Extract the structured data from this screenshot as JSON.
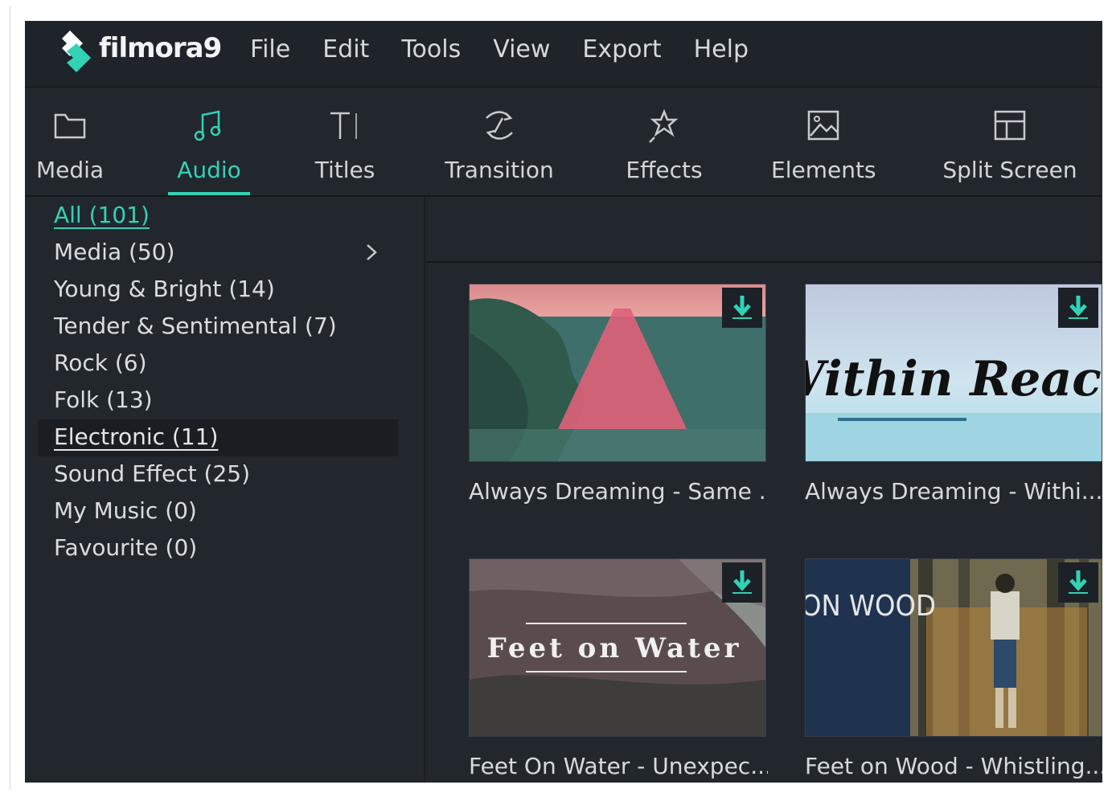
{
  "app": {
    "brand": "filmora9"
  },
  "menu": [
    "File",
    "Edit",
    "Tools",
    "View",
    "Export",
    "Help"
  ],
  "toolbar": {
    "tabs": [
      {
        "label": "Media",
        "icon": "folder-icon"
      },
      {
        "label": "Audio",
        "icon": "music-note-icon"
      },
      {
        "label": "Titles",
        "icon": "text-icon"
      },
      {
        "label": "Transition",
        "icon": "transition-icon"
      },
      {
        "label": "Effects",
        "icon": "effects-star-icon"
      },
      {
        "label": "Elements",
        "icon": "image-icon"
      },
      {
        "label": "Split Screen",
        "icon": "split-screen-icon"
      }
    ],
    "active": "Audio"
  },
  "sidebar": {
    "categories": [
      "All (101)",
      "Media (50)",
      "Young & Bright (14)",
      "Tender & Sentimental (7)",
      "Rock (6)",
      "Folk (13)",
      "Electronic (11)",
      "Sound Effect (25)",
      "My Music (0)",
      "Favourite (0)"
    ],
    "active": "All (101)",
    "selected_row": "Electronic (11)"
  },
  "tracks": [
    {
      "title": "Always Dreaming - Same ...",
      "thumb_text": ""
    },
    {
      "title": "Always Dreaming - Withi...",
      "thumb_text": "Within Reach"
    },
    {
      "title": "Feet On Water - Unexpec...",
      "thumb_text": "Feet on Water"
    },
    {
      "title": "Feet on Wood - Whistling...",
      "thumb_text": "ON WOOD"
    }
  ],
  "colors": {
    "accent": "#32d2b5",
    "background": "#22272e",
    "menubar": "#1f242a"
  }
}
